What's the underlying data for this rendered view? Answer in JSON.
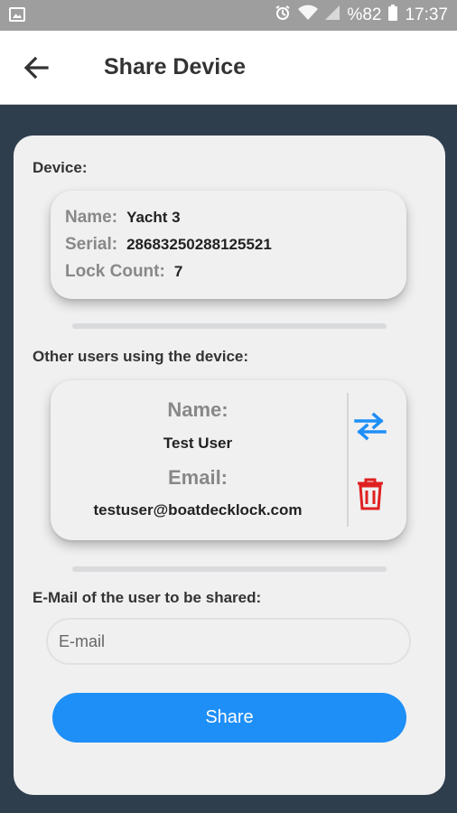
{
  "status_bar": {
    "battery": "%82",
    "time": "17:37"
  },
  "header": {
    "title": "Share Device"
  },
  "device": {
    "section_label": "Device:",
    "name_key": "Name:",
    "name_value": "Yacht 3",
    "serial_key": "Serial:",
    "serial_value": "28683250288125521",
    "lockcount_key": "Lock Count:",
    "lockcount_value": "7"
  },
  "other_users": {
    "section_label": "Other users using the device:",
    "name_label": "Name:",
    "name_value": "Test User",
    "email_label": "Email:",
    "email_value": "testuser@boatdecklock.com"
  },
  "share": {
    "section_label": "E-Mail of the user to be shared:",
    "email_placeholder": "E-mail",
    "button_label": "Share"
  },
  "colors": {
    "accent": "#1e8ff7",
    "delete": "#e02020",
    "background": "#2f3e4d",
    "card": "#f0f0f1"
  },
  "icons": [
    "image-notification-icon",
    "alarm-icon",
    "wifi-icon",
    "signal-icon",
    "battery-icon",
    "back-arrow-icon",
    "swap-arrows-icon",
    "trash-icon"
  ]
}
